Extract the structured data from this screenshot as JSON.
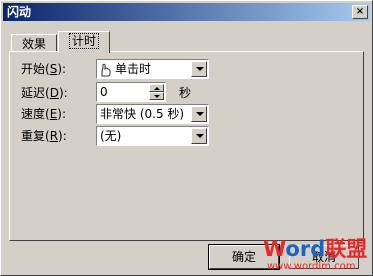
{
  "window": {
    "title": "闪动",
    "close_label": "×"
  },
  "tabs": [
    {
      "label": "效果"
    },
    {
      "label": "计时"
    }
  ],
  "form": {
    "start": {
      "label_text": "开始",
      "shortcut": "S",
      "value": "单击时"
    },
    "delay": {
      "label_text": "延迟",
      "shortcut": "D",
      "value": "0",
      "unit": "秒"
    },
    "speed": {
      "label_text": "速度",
      "shortcut": "E",
      "value": "非常快 (0.5 秒)"
    },
    "repeat": {
      "label_text": "重复",
      "shortcut": "R",
      "value": "(无)"
    }
  },
  "buttons": {
    "ok": "确定",
    "cancel": "取消"
  },
  "watermark": {
    "logo_part1": "W",
    "logo_part2": "ord",
    "logo_part3": "联盟",
    "url": "www.wordlm.com"
  },
  "icons": {
    "start_combo_icon": "mouse-icon",
    "close": "close-icon",
    "dropdown": "chevron-down-icon"
  }
}
